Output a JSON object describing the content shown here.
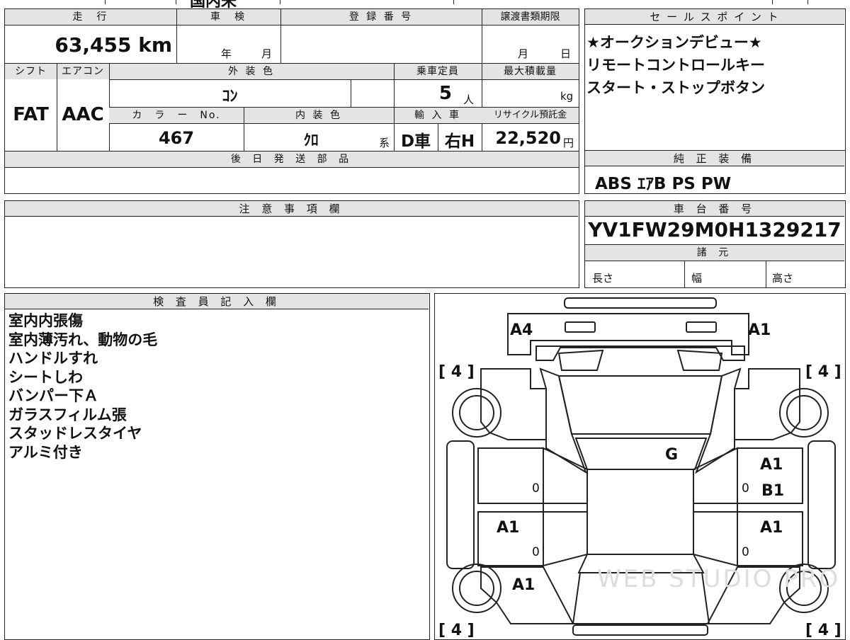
{
  "top_strip": {
    "partial_text": "国内未"
  },
  "summary": {
    "labels": {
      "mileage": "走　行",
      "inspection": "車　検",
      "registration": "登 録 番 号",
      "transfer_deadline": "譲渡書類期限",
      "shift": "シフト",
      "aircon": "エアコン",
      "exterior_color": "外 装 色",
      "capacity": "乗車定員",
      "max_load": "最大積載量",
      "color_no": "カ　ラ　ー　No.",
      "interior_color": "内 装 色",
      "import": "輸 入 車",
      "recycle": "リサイクル預託金",
      "later_parts": "後 日 発 送 部 品"
    },
    "mileage_value": "63,455 km",
    "inspection_year": "年",
    "inspection_month": "月",
    "transfer_month": "月",
    "transfer_day": "日",
    "shift_value": "FAT",
    "aircon_value": "AAC",
    "exterior_color_value": "ｺﾝ",
    "capacity_value": "5",
    "capacity_unit": "人",
    "max_load_unit": "kg",
    "color_no_value": "467",
    "interior_color_value": "ｸﾛ",
    "interior_suffix": "系",
    "import_type": "D車",
    "steering": "右H",
    "recycle_value": "22,520",
    "recycle_unit": "円"
  },
  "sales_points": {
    "title": "セ ー ル ス ポ イ ン ト",
    "items": [
      "★オークションデビュー★",
      "リモートコントロールキー",
      "スタート・ストップボタン"
    ]
  },
  "equipment": {
    "title": "純 正 装 備",
    "value": "ABS ｴｱB PS PW"
  },
  "caution": {
    "title": "注 意 事 項 欄"
  },
  "chassis": {
    "title": "車 台 番 号",
    "value": "YV1FW29M0H1329217",
    "specs_title": "諸 元",
    "length": "長さ",
    "width": "幅",
    "height": "高さ"
  },
  "inspector": {
    "title": "検 査 員 記 入 欄",
    "notes": [
      "室内内張傷",
      "室内薄汚れ、動物の毛",
      "ハンドルすれ",
      "シートしわ",
      "バンパー下Ａ",
      "ガラスフィルム張",
      "スタッドレスタイヤ",
      "アルミ付き"
    ]
  },
  "diagram": {
    "marks": {
      "front_left": "A4",
      "front_right": "A1",
      "windshield": "G",
      "right_front_door_1": "A1",
      "right_front_door_2": "B1",
      "left_rear_door": "A1",
      "right_rear_door": "A1",
      "left_rear_quarter": "A1"
    },
    "tires": {
      "front_left": "[ 4 ]",
      "front_right": "[ 4 ]",
      "rear_left": "[ 4 ]",
      "rear_right": "[ 4 ]"
    },
    "door_zeros": [
      "0",
      "0",
      "0",
      "0"
    ],
    "watermark": "WEB STUDIO PRO"
  },
  "colors": {
    "header_bg": "#e4e4e4",
    "line": "#222222"
  }
}
